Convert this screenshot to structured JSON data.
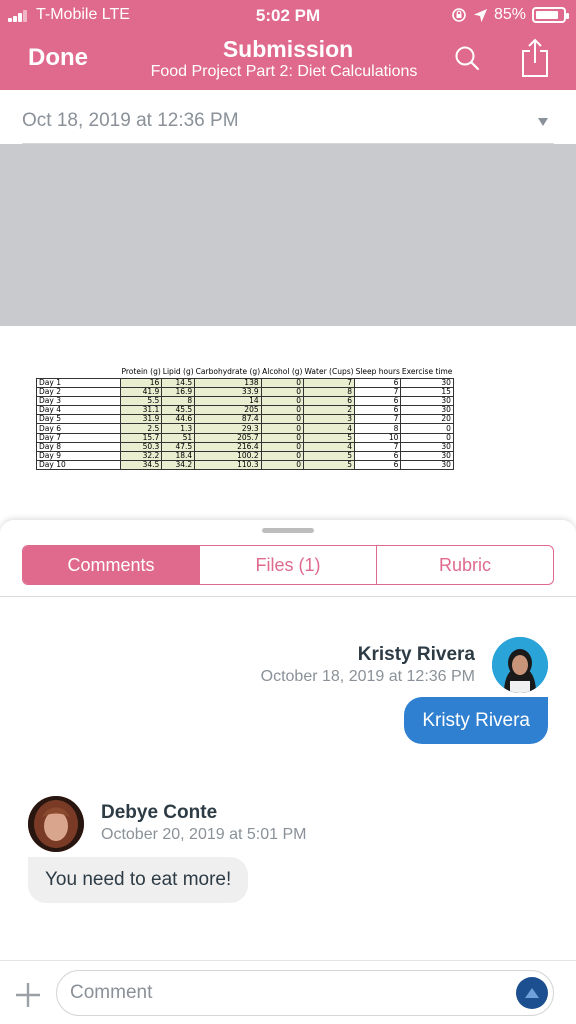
{
  "status_bar": {
    "carrier": "T-Mobile  LTE",
    "time": "5:02 PM",
    "battery": "85%",
    "battery_level": 0.85
  },
  "header": {
    "done_label": "Done",
    "title": "Submission",
    "subtitle": "Food Project Part 2: Diet Calculations",
    "color": "#e06a8e"
  },
  "submission": {
    "date": "Oct 18, 2019 at 12:36 PM"
  },
  "spreadsheet": {
    "headers": [
      "Protein (g)",
      "Lipid (g)",
      "Carbohydrate (g)",
      "Alcohol (g)",
      "Water (Cups)",
      "Sleep hours",
      "Exercise time"
    ],
    "rows": [
      {
        "day": "Day 1",
        "values": [
          "16",
          "14.5",
          "138",
          "0",
          "7",
          "6",
          "30"
        ]
      },
      {
        "day": "Day 2",
        "values": [
          "41.9",
          "16.9",
          "33.9",
          "0",
          "8",
          "7",
          "15"
        ]
      },
      {
        "day": "Day 3",
        "values": [
          "5.5",
          "8",
          "14",
          "0",
          "6",
          "6",
          "30"
        ]
      },
      {
        "day": "Day 4",
        "values": [
          "31.1",
          "45.5",
          "205",
          "0",
          "2",
          "6",
          "30"
        ]
      },
      {
        "day": "Day 5",
        "values": [
          "31.9",
          "44.6",
          "87.4",
          "0",
          "3",
          "7",
          "20"
        ]
      },
      {
        "day": "Day 6",
        "values": [
          "2.5",
          "1.3",
          "29.3",
          "0",
          "4",
          "8",
          "0"
        ]
      },
      {
        "day": "Day 7",
        "values": [
          "15.7",
          "51",
          "205.7",
          "0",
          "5",
          "10",
          "0"
        ]
      },
      {
        "day": "Day 8",
        "values": [
          "50.3",
          "47.5",
          "216.4",
          "0",
          "4",
          "7",
          "30"
        ]
      },
      {
        "day": "Day 9",
        "values": [
          "32.2",
          "18.4",
          "100.2",
          "0",
          "5",
          "6",
          "30"
        ]
      },
      {
        "day": "Day 10",
        "values": [
          "34.5",
          "34.2",
          "110.3",
          "0",
          "5",
          "6",
          "30"
        ]
      }
    ]
  },
  "tabs": [
    {
      "label": "Comments"
    },
    {
      "label": "Files (1)"
    },
    {
      "label": "Rubric"
    }
  ],
  "comments": [
    {
      "author": "Kristy Rivera",
      "date": "October 18, 2019 at 12:36 PM",
      "text": "Kristy Rivera"
    },
    {
      "author": "Debye Conte",
      "date": "October 20, 2019 at 5:01 PM",
      "text": "You need to eat more!"
    }
  ],
  "compose": {
    "placeholder": "Comment"
  }
}
